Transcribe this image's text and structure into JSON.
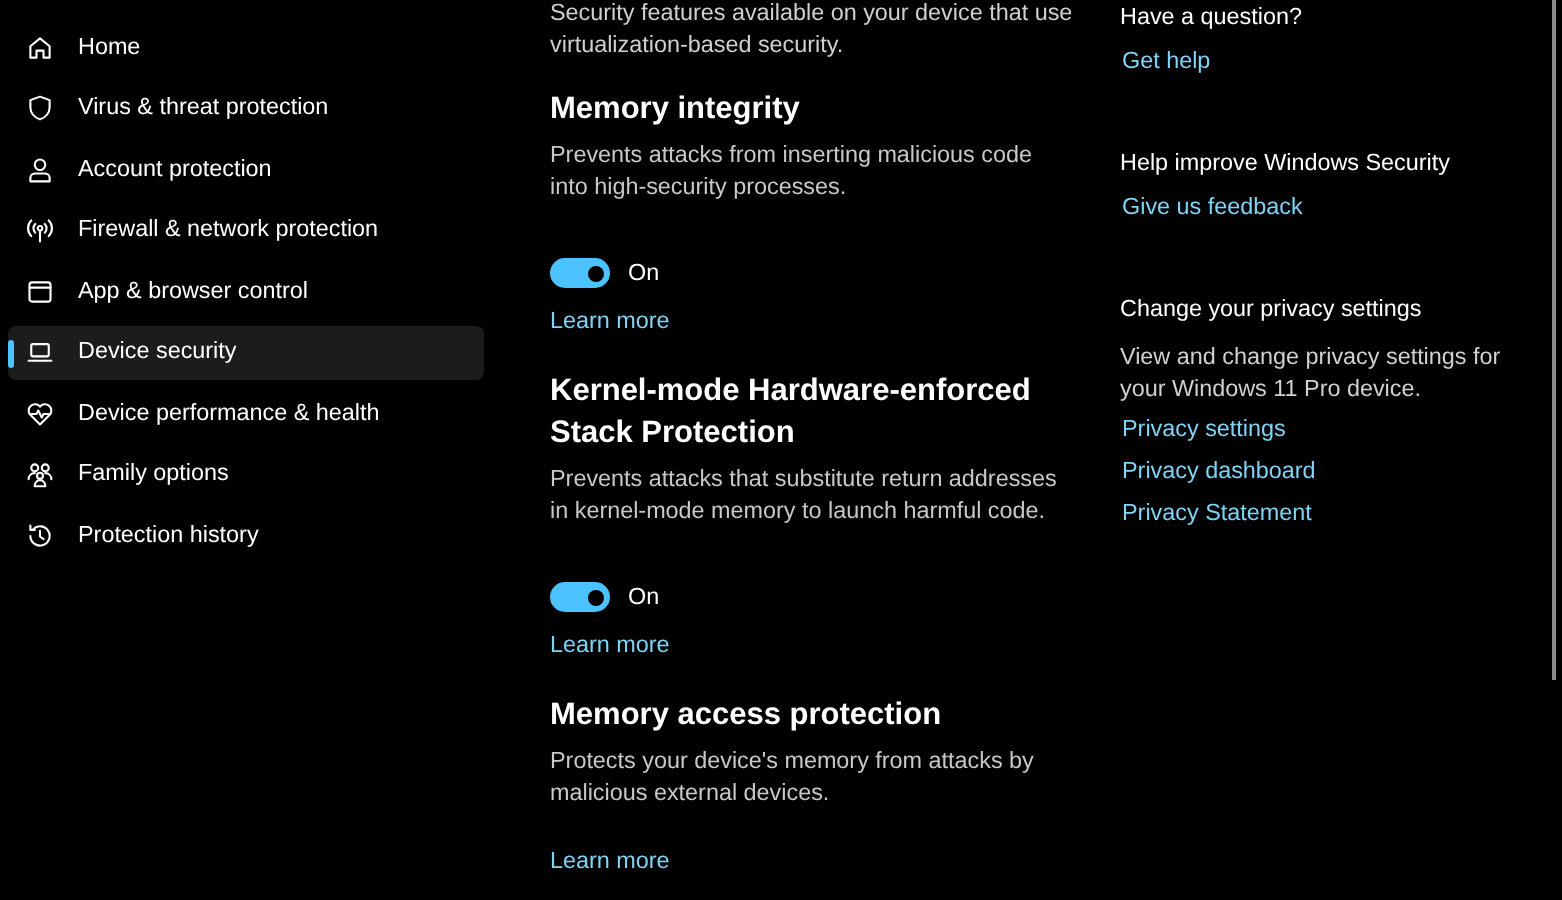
{
  "sidebar": {
    "items": [
      {
        "label": "Home",
        "selected": false
      },
      {
        "label": "Virus & threat protection",
        "selected": false
      },
      {
        "label": "Account protection",
        "selected": false
      },
      {
        "label": "Firewall & network protection",
        "selected": false
      },
      {
        "label": "App & browser control",
        "selected": false
      },
      {
        "label": "Device security",
        "selected": true
      },
      {
        "label": "Device performance & health",
        "selected": false
      },
      {
        "label": "Family options",
        "selected": false
      },
      {
        "label": "Protection history",
        "selected": false
      }
    ]
  },
  "main": {
    "intro": "Security features available on your device that use virtualization-based security.",
    "features": [
      {
        "title": "Memory integrity",
        "description": "Prevents attacks from inserting malicious code into high-security processes.",
        "toggle": {
          "on": true,
          "label": "On"
        },
        "link": "Learn more"
      },
      {
        "title": "Kernel-mode Hardware-enforced Stack Protection",
        "description": "Prevents attacks that substitute return addresses in kernel-mode memory to launch harmful code.",
        "toggle": {
          "on": true,
          "label": "On"
        },
        "link": "Learn more"
      },
      {
        "title": "Memory access protection",
        "description": "Protects your device's memory from attacks by malicious external devices.",
        "link": "Learn more"
      }
    ]
  },
  "aside": {
    "panels": [
      {
        "heading": "Have a question?",
        "links": [
          "Get help"
        ]
      },
      {
        "heading": "Help improve Windows Security",
        "links": [
          "Give us feedback"
        ]
      },
      {
        "heading": "Change your privacy settings",
        "description": "View and change privacy settings for your Windows 11 Pro device.",
        "links": [
          "Privacy settings",
          "Privacy dashboard",
          "Privacy Statement"
        ]
      }
    ]
  }
}
